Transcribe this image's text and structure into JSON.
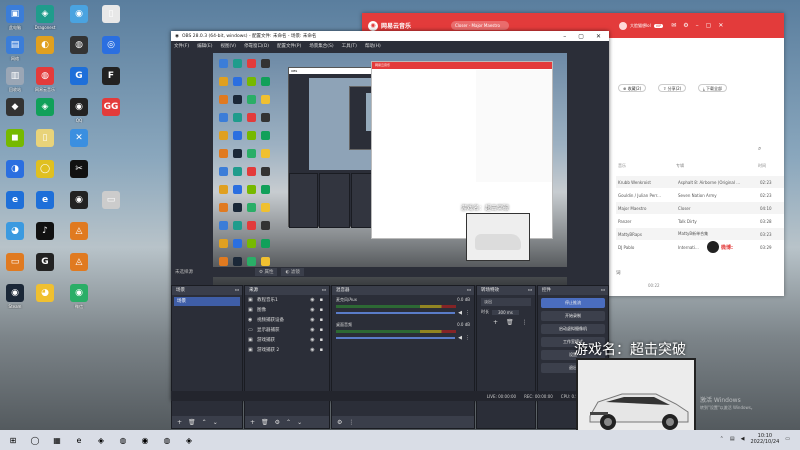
{
  "desktop": {
    "icons": [
      {
        "label": "此电脑",
        "glyph": "▣",
        "color": "#3b7dd8"
      },
      {
        "label": "Dragonest",
        "glyph": "◈",
        "color": "#1f9c8c"
      },
      {
        "label": "",
        "glyph": "◉",
        "color": "#4aa3e0"
      },
      {
        "label": "",
        "glyph": "▯",
        "color": "#e8e8e8"
      },
      {
        "label": "网络",
        "glyph": "▤",
        "color": "#3b7dd8"
      },
      {
        "label": "",
        "glyph": "◐",
        "color": "#e0a020"
      },
      {
        "label": "",
        "glyph": "◍",
        "color": "#333"
      },
      {
        "label": "",
        "glyph": "◎",
        "color": "#2b6fe0"
      },
      {
        "label": "回收站",
        "glyph": "▥",
        "color": "#9aa6b5"
      },
      {
        "label": "网易云音乐",
        "glyph": "◍",
        "color": "#e33b3b"
      },
      {
        "label": "",
        "glyph": "G",
        "color": "#1e6fd9"
      },
      {
        "label": "",
        "glyph": "F",
        "color": "#222"
      },
      {
        "label": "",
        "glyph": "◆",
        "color": "#333"
      },
      {
        "label": "",
        "glyph": "◈",
        "color": "#11a05a"
      },
      {
        "label": "QQ",
        "glyph": "◉",
        "color": "#222"
      },
      {
        "label": "",
        "glyph": "GG",
        "color": "#e33b3b"
      },
      {
        "label": "",
        "glyph": "◼",
        "color": "#76b900"
      },
      {
        "label": "",
        "glyph": "▯",
        "color": "#e8d37a"
      },
      {
        "label": "",
        "glyph": "✕",
        "color": "#3b8fe0"
      },
      {
        "label": "",
        "glyph": "",
        "color": "transparent"
      },
      {
        "label": "",
        "glyph": "◑",
        "color": "#2b6fe0"
      },
      {
        "label": "",
        "glyph": "◯",
        "color": "#e0c020"
      },
      {
        "label": "",
        "glyph": "✂",
        "color": "#111"
      },
      {
        "label": "",
        "glyph": "",
        "color": "transparent"
      },
      {
        "label": "",
        "glyph": "e",
        "color": "#1e6fd9"
      },
      {
        "label": "",
        "glyph": "e",
        "color": "#1e6fd9"
      },
      {
        "label": "",
        "glyph": "◉",
        "color": "#222"
      },
      {
        "label": "",
        "glyph": "▭",
        "color": "#ccc"
      },
      {
        "label": "",
        "glyph": "◕",
        "color": "#3b9ae0"
      },
      {
        "label": "",
        "glyph": "♪",
        "color": "#111"
      },
      {
        "label": "",
        "glyph": "◬",
        "color": "#e07a20"
      },
      {
        "label": "",
        "glyph": "",
        "color": "transparent"
      },
      {
        "label": "",
        "glyph": "▭",
        "color": "#e07a20"
      },
      {
        "label": "",
        "glyph": "G",
        "color": "#222"
      },
      {
        "label": "",
        "glyph": "◬",
        "color": "#e07a20"
      },
      {
        "label": "",
        "glyph": "",
        "color": "transparent"
      },
      {
        "label": "Steam",
        "glyph": "◉",
        "color": "#1b2838"
      },
      {
        "label": "",
        "glyph": "◕",
        "color": "#f0c030"
      },
      {
        "label": "微信",
        "glyph": "◉",
        "color": "#2aae67"
      },
      {
        "label": "",
        "glyph": "",
        "color": "transparent"
      }
    ]
  },
  "taskbar": {
    "time": "10:10",
    "date": "2022/10/24",
    "lang": "",
    "apps": [
      "⊞",
      "◯",
      "▦",
      "e",
      "◈",
      "◍",
      "◉",
      "◍",
      "◈"
    ]
  },
  "music": {
    "app_name": "网易云音乐",
    "search_text": "Closer - Major Maestro",
    "user": "大脸猫想lol",
    "vip": "VIP",
    "share_label": "分享(2)",
    "download_label": "下载全部",
    "collect_label": "收藏(2)",
    "col_title": "音乐",
    "col_artist": "专辑",
    "col_time": "时间",
    "rows": [
      {
        "title": "Krubb Wenkroist",
        "artist": "Asphalt 8: Airborne (Original ...",
        "time": "02:23"
      },
      {
        "title": "Gouldin / Julian Perr...",
        "artist": "Seven Nation Army",
        "time": "02:23"
      },
      {
        "title": "Major Maestro",
        "artist": "Closer",
        "time": "04:10"
      },
      {
        "title": "Panzer",
        "artist": "Talk Dirty",
        "time": "03:28"
      },
      {
        "title": "MattyBRaps",
        "artist": "MattyB新单合集",
        "time": "03:23"
      },
      {
        "title": "DJ Pablo",
        "artist": "Internati...",
        "time": "03:29"
      }
    ],
    "footer_text": "词",
    "progress_time": "00:22"
  },
  "obs": {
    "title": "OBS 28.0.3 (64-bit, windows) - 配置文件: 未命名 - 场景: 未命名",
    "menu": [
      "文件(F)",
      "编辑(E)",
      "视图(V)",
      "停靠窗口(D)",
      "配置文件(P)",
      "场景集合(S)",
      "工具(T)",
      "帮助(H)"
    ],
    "source_label": "未选择源",
    "props_label": "属性",
    "filter_label": "滤镜",
    "scenes": {
      "header": "场景",
      "items": [
        "场景"
      ]
    },
    "sources": {
      "header": "来源",
      "items": [
        {
          "icon": "▣",
          "name": "教程音乐1"
        },
        {
          "icon": "▣",
          "name": "图像"
        },
        {
          "icon": "◉",
          "name": "视频捕获设备"
        },
        {
          "icon": "▭",
          "name": "显示器捕获"
        },
        {
          "icon": "▣",
          "name": "游戏捕获"
        },
        {
          "icon": "▣",
          "name": "游戏捕获 2"
        }
      ]
    },
    "mixer": {
      "header": "混音器",
      "ch1_name": "麦克风/Aux",
      "ch1_db": "0.0 dB",
      "ch2_name": "桌面音频",
      "ch2_db": "0.0 dB"
    },
    "transitions": {
      "header": "转场特效",
      "type": "淡出",
      "duration_label": "时长",
      "duration": "300 ms"
    },
    "controls": {
      "header": "控件",
      "buttons": [
        "停止推流",
        "开始录制",
        "启动虚拟摄像机",
        "工作室模式",
        "设置",
        "退出"
      ]
    },
    "status": {
      "live": "LIVE: 00:00:00",
      "rec": "REC: 00:00:00",
      "cpu": "CPU: 0.5%, 60.00 fps"
    },
    "preview_inner_title": "网易云音乐",
    "preview_inner_obs_title": "OBS",
    "overlay_game_text": "游戏名：超击突破"
  },
  "overlay": {
    "game_label": "游戏名：超击突破",
    "watermark_a": "微博:",
    "watermark_b": "",
    "win_activate_1": "激活 Windows",
    "win_activate_2": "转到\"设置\"以激活 Windows。"
  },
  "colors": {
    "netease_red": "#e33b3b",
    "obs_bg": "#2b2e38",
    "obs_active": "#4a6dbf"
  }
}
